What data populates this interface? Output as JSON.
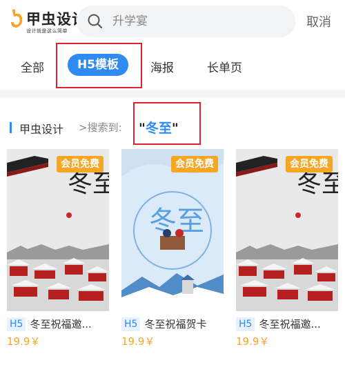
{
  "header": {
    "logo_text": "甲虫设计",
    "logo_slogan": "设计就是这么简单",
    "search_placeholder": "升学宴",
    "cancel_label": "取消"
  },
  "tabs": [
    {
      "label": "全部",
      "active": false
    },
    {
      "label": "H5模板",
      "active": true
    },
    {
      "label": "海报",
      "active": false
    },
    {
      "label": "长单页",
      "active": false
    }
  ],
  "breadcrumb": {
    "site": "甲虫设计",
    "separator": ">搜索到:",
    "quote_open": "\"",
    "keyword": "冬至",
    "quote_close": "\""
  },
  "cards": [
    {
      "badge": "会员免费",
      "tag": "H5",
      "name": "冬至祝福邀...",
      "price": "19.9￥",
      "art_text": "冬至"
    },
    {
      "badge": "会员免费",
      "tag": "H5",
      "name": "冬至祝福贺卡",
      "price": "19.9￥",
      "art_text": "冬至"
    },
    {
      "badge": "会员免费",
      "tag": "H5",
      "name": "冬至祝福邀...",
      "price": "19.9￥",
      "art_text": "冬至"
    }
  ],
  "colors": {
    "accent": "#2f8bf0",
    "badge": "#f5a623",
    "price": "#f5a623",
    "highlight": "#e0212b"
  }
}
